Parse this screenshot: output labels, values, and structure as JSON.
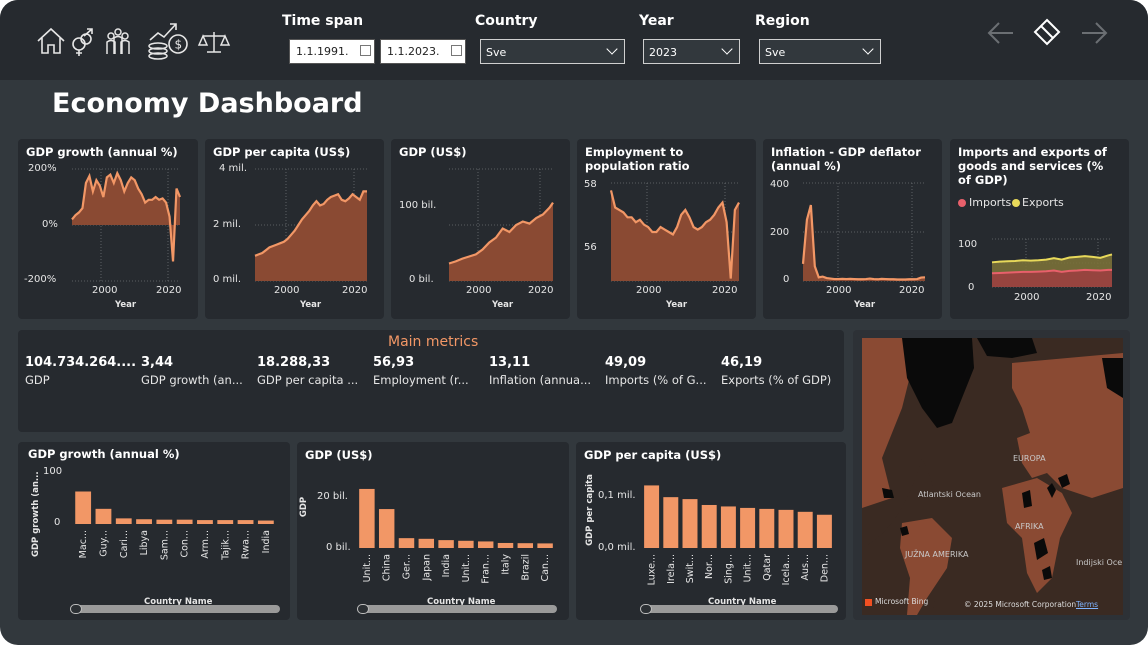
{
  "page_title": "Economy Dashboard",
  "nav_icons": [
    "home-icon",
    "gender-icon",
    "population-icon",
    "money-growth-icon",
    "balance-scale-icon"
  ],
  "filters": {
    "time_span_label": "Time span",
    "date_from": "1.1.1991.",
    "date_to": "1.1.2023.",
    "country_label": "Country",
    "country_value": "Sve",
    "year_label": "Year",
    "year_value": "2023",
    "region_label": "Region",
    "region_value": "Sve"
  },
  "top_charts": {
    "gdp_growth": {
      "title": "GDP growth (annual %)",
      "yticks": [
        "200%",
        "0%",
        "-200%"
      ],
      "xticks": [
        "2000",
        "2020"
      ],
      "xlabel": "Year"
    },
    "gdp_per_capita": {
      "title": "GDP per capita (US$)",
      "yticks": [
        "4 mil.",
        "2 mil.",
        "0 mil."
      ],
      "xticks": [
        "2000",
        "2020"
      ],
      "xlabel": "Year"
    },
    "gdp_usd": {
      "title": "GDP (US$)",
      "yticks": [
        "100 bil.",
        "0 bil."
      ],
      "xticks": [
        "2000",
        "2020"
      ],
      "xlabel": "Year"
    },
    "employment": {
      "title": "Employment to population ratio",
      "yticks": [
        "58",
        "56"
      ],
      "xticks": [
        "2000",
        "2020"
      ],
      "xlabel": "Year"
    },
    "inflation": {
      "title": "Inflation - GDP deflator (annual %)",
      "yticks": [
        "400",
        "200",
        "0"
      ],
      "xticks": [
        "2000",
        "2020"
      ],
      "xlabel": "Year"
    },
    "imports_exports": {
      "title": "Imports and exports of goods and services (% of GDP)",
      "legend_imports": "Imports",
      "legend_exports": "Exports",
      "yticks": [
        "100",
        "0"
      ],
      "xticks": [
        "2000",
        "2020"
      ]
    }
  },
  "main_metrics": {
    "title": "Main metrics",
    "items": [
      {
        "value": "104.734.264....",
        "label": "GDP"
      },
      {
        "value": "3,44",
        "label": "GDP growth (an..."
      },
      {
        "value": "18.288,33",
        "label": "GDP per capita ..."
      },
      {
        "value": "56,93",
        "label": "Employment (r..."
      },
      {
        "value": "13,11",
        "label": "Inflation (annua..."
      },
      {
        "value": "49,09",
        "label": "Imports (% of G..."
      },
      {
        "value": "46,19",
        "label": "Exports (% of GDP)"
      }
    ]
  },
  "bottom_charts": {
    "growth": {
      "title": "GDP growth (annual %)",
      "ylabel": "GDP growth (an...",
      "xlabel": "Country Name",
      "yticks": [
        "100",
        "0"
      ]
    },
    "gdp": {
      "title": "GDP (US$)",
      "ylabel": "GDP",
      "xlabel": "Country Name",
      "yticks": [
        "20 bil.",
        "0 bil."
      ]
    },
    "per_capita": {
      "title": "GDP per capita (US$)",
      "ylabel": "GDP per capita",
      "xlabel": "Country Name",
      "yticks": [
        "0,1 mil.",
        "0,0 mil."
      ]
    }
  },
  "map": {
    "labels": [
      "EUROPA",
      "Atlantski Ocean",
      "AFRIKA",
      "JUŽNA AMERIKA",
      "Indijski Oce"
    ],
    "brand": "Microsoft Bing",
    "copyright": "© 2025 Microsoft Corporation",
    "terms": "Terms"
  },
  "colors": {
    "accent": "#f29766",
    "area_fill": "#8a4a33",
    "imports": "#e8606b",
    "exports": "#e8d95a",
    "card_bg": "#262a2f",
    "page_bg": "#32383d"
  },
  "chart_data": [
    {
      "type": "area",
      "title": "GDP growth (annual %)",
      "xlabel": "Year",
      "ylabel": "",
      "ylim": [
        -200,
        200
      ],
      "x": [
        1991,
        1992,
        1993,
        1994,
        1995,
        1996,
        1997,
        1998,
        1999,
        2000,
        2001,
        2002,
        2003,
        2004,
        2005,
        2006,
        2007,
        2008,
        2009,
        2010,
        2011,
        2012,
        2013,
        2014,
        2015,
        2016,
        2017,
        2018,
        2019,
        2020,
        2021,
        2022
      ],
      "values": [
        20,
        35,
        45,
        60,
        150,
        175,
        120,
        160,
        140,
        100,
        170,
        180,
        150,
        185,
        160,
        120,
        150,
        170,
        160,
        130,
        110,
        80,
        90,
        90,
        100,
        90,
        95,
        80,
        30,
        -130,
        130,
        100
      ]
    },
    {
      "type": "area",
      "title": "GDP per capita (US$)",
      "xlabel": "Year",
      "ylabel": "",
      "ylim": [
        0,
        4000000
      ],
      "x": [
        1991,
        1992,
        1993,
        1994,
        1995,
        1996,
        1997,
        1998,
        1999,
        2000,
        2001,
        2002,
        2003,
        2004,
        2005,
        2006,
        2007,
        2008,
        2009,
        2010,
        2011,
        2012,
        2013,
        2014,
        2015,
        2016,
        2017,
        2018,
        2019,
        2020,
        2021,
        2022
      ],
      "values": [
        900000,
        950000,
        1000000,
        1100000,
        1200000,
        1250000,
        1300000,
        1350000,
        1400000,
        1500000,
        1650000,
        1800000,
        2000000,
        2200000,
        2350000,
        2500000,
        2700000,
        2850000,
        2700000,
        2750000,
        2900000,
        3000000,
        3050000,
        3100000,
        2900000,
        2850000,
        2950000,
        3100000,
        3000000,
        2900000,
        3200000,
        3200000
      ]
    },
    {
      "type": "area",
      "title": "GDP (US$)",
      "xlabel": "Year",
      "ylabel": "",
      "ylim": [
        0,
        160000000000
      ],
      "x": [
        1991,
        1993,
        1995,
        1997,
        1999,
        2001,
        2003,
        2005,
        2007,
        2009,
        2011,
        2013,
        2015,
        2017,
        2019,
        2021,
        2022
      ],
      "values": [
        25000000000,
        28000000000,
        32000000000,
        35000000000,
        38000000000,
        45000000000,
        55000000000,
        62000000000,
        75000000000,
        70000000000,
        80000000000,
        85000000000,
        82000000000,
        90000000000,
        95000000000,
        105000000000,
        112000000000
      ]
    },
    {
      "type": "area",
      "title": "Employment to population ratio",
      "xlabel": "Year",
      "ylabel": "",
      "ylim": [
        54,
        58
      ],
      "x": [
        1991,
        1992,
        1993,
        1994,
        1995,
        1996,
        1997,
        1998,
        1999,
        2000,
        2001,
        2002,
        2003,
        2004,
        2005,
        2006,
        2007,
        2008,
        2009,
        2010,
        2011,
        2012,
        2013,
        2014,
        2015,
        2016,
        2017,
        2018,
        2019,
        2020,
        2021,
        2022
      ],
      "values": [
        57.7,
        57.0,
        56.9,
        56.8,
        56.6,
        56.6,
        56.4,
        56.5,
        56.3,
        56.2,
        56.0,
        56.0,
        56.2,
        56.1,
        56.0,
        55.9,
        56.2,
        56.7,
        56.9,
        56.6,
        56.2,
        56.1,
        56.2,
        56.4,
        56.5,
        56.7,
        57.0,
        57.2,
        56.4,
        54.1,
        56.9,
        57.2
      ]
    },
    {
      "type": "area",
      "title": "Inflation - GDP deflator (annual %)",
      "xlabel": "Year",
      "ylabel": "",
      "ylim": [
        0,
        400
      ],
      "x": [
        1991,
        1992,
        1993,
        1994,
        1995,
        1996,
        1997,
        1998,
        1999,
        2000,
        2001,
        2002,
        2003,
        2004,
        2005,
        2006,
        2007,
        2008,
        2009,
        2010,
        2011,
        2012,
        2013,
        2014,
        2015,
        2016,
        2017,
        2018,
        2019,
        2020,
        2021,
        2022
      ],
      "values": [
        70,
        250,
        310,
        60,
        15,
        18,
        12,
        10,
        8,
        8,
        9,
        8,
        9,
        8,
        7,
        7,
        8,
        10,
        8,
        7,
        9,
        8,
        7,
        7,
        6,
        6,
        6,
        7,
        7,
        8,
        14,
        15
      ]
    },
    {
      "type": "area",
      "title": "Imports and exports of goods and services (% of GDP)",
      "xlabel": "",
      "ylabel": "",
      "ylim": [
        0,
        140
      ],
      "x": [
        1991,
        1993,
        1995,
        1997,
        1999,
        2001,
        2003,
        2005,
        2007,
        2009,
        2011,
        2013,
        2015,
        2017,
        2019,
        2021,
        2022
      ],
      "series": [
        {
          "name": "Imports",
          "values": [
            40,
            41,
            42,
            43,
            44,
            44,
            45,
            46,
            48,
            44,
            47,
            48,
            50,
            49,
            48,
            50,
            50
          ]
        },
        {
          "name": "Exports",
          "values": [
            72,
            74,
            75,
            76,
            78,
            77,
            78,
            80,
            84,
            80,
            86,
            88,
            90,
            88,
            85,
            92,
            95
          ]
        }
      ]
    },
    {
      "type": "bar",
      "title": "GDP growth (annual %)",
      "xlabel": "Country Name",
      "ylabel": "GDP growth (an...",
      "ylim": [
        0,
        120
      ],
      "categories": [
        "Mac...",
        "Guy...",
        "Cari...",
        "Libya",
        "Sam...",
        "Con...",
        "Arm...",
        "Tajik...",
        "Rwa...",
        "India"
      ],
      "values": [
        75,
        35,
        13,
        11,
        10,
        10,
        9,
        9,
        9,
        8
      ]
    },
    {
      "type": "bar",
      "title": "GDP (US$)",
      "xlabel": "Country Name",
      "ylabel": "GDP",
      "ylim": [
        0,
        32
      ],
      "categories": [
        "Unit...",
        "China",
        "Ger...",
        "Japan",
        "India",
        "Unit...",
        "Fran...",
        "Italy",
        "Brazil",
        "Can..."
      ],
      "values": [
        27,
        17.8,
        4.5,
        4.2,
        3.6,
        3.3,
        3.0,
        2.3,
        2.2,
        2.1
      ]
    },
    {
      "type": "bar",
      "title": "GDP per capita (US$)",
      "xlabel": "Country Name",
      "ylabel": "GDP per capita",
      "ylim": [
        0,
        0.135
      ],
      "categories": [
        "Luxe...",
        "Irela...",
        "Swit...",
        "Nor...",
        "Sing...",
        "Unit...",
        "Qatar",
        "Icela...",
        "Aus...",
        "Den..."
      ],
      "values": [
        0.128,
        0.104,
        0.1,
        0.088,
        0.085,
        0.082,
        0.08,
        0.078,
        0.074,
        0.068
      ]
    }
  ]
}
